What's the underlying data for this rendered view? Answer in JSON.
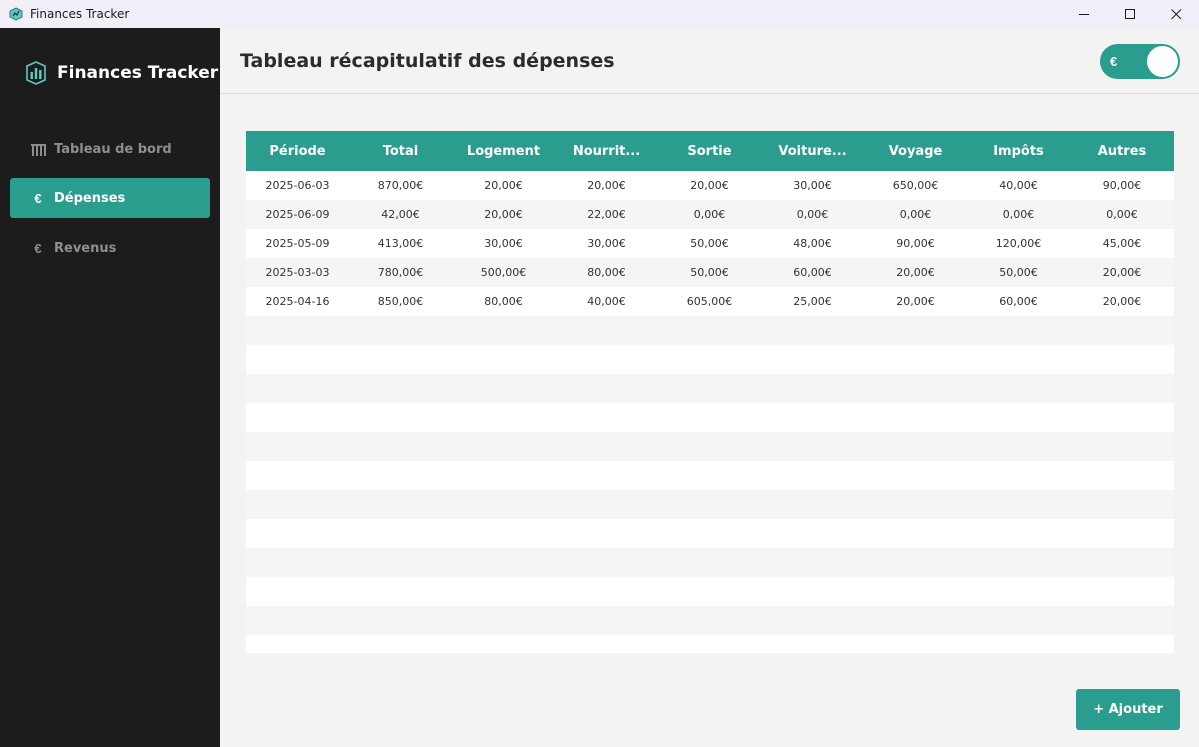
{
  "window": {
    "title": "Finances Tracker"
  },
  "sidebar": {
    "brand": "Finances Tracker",
    "items": [
      {
        "label": "Tableau de bord",
        "icon": "chart-bars-icon",
        "active": false
      },
      {
        "label": "Dépenses",
        "icon": "euro-icon",
        "active": true
      },
      {
        "label": "Revenus",
        "icon": "euro-icon",
        "active": false
      }
    ]
  },
  "header": {
    "title": "Tableau récapitulatif des dépenses",
    "currency_toggle": {
      "label": "€",
      "on": true
    }
  },
  "table": {
    "columns": [
      "Période",
      "Total",
      "Logement",
      "Nourrit...",
      "Sortie",
      "Voiture...",
      "Voyage",
      "Impôts",
      "Autres"
    ],
    "rows": [
      [
        "2025-06-03",
        "870,00€",
        "20,00€",
        "20,00€",
        "20,00€",
        "30,00€",
        "650,00€",
        "40,00€",
        "90,00€"
      ],
      [
        "2025-06-09",
        "42,00€",
        "20,00€",
        "22,00€",
        "0,00€",
        "0,00€",
        "0,00€",
        "0,00€",
        "0,00€"
      ],
      [
        "2025-05-09",
        "413,00€",
        "30,00€",
        "30,00€",
        "50,00€",
        "48,00€",
        "90,00€",
        "120,00€",
        "45,00€"
      ],
      [
        "2025-03-03",
        "780,00€",
        "500,00€",
        "80,00€",
        "50,00€",
        "60,00€",
        "20,00€",
        "50,00€",
        "20,00€"
      ],
      [
        "2025-04-16",
        "850,00€",
        "80,00€",
        "40,00€",
        "605,00€",
        "25,00€",
        "20,00€",
        "60,00€",
        "20,00€"
      ]
    ]
  },
  "actions": {
    "add_label": "+ Ajouter"
  },
  "colors": {
    "accent": "#2a9d8f",
    "sidebar_bg": "#1c1c1c",
    "page_bg": "#f3f3f3"
  }
}
